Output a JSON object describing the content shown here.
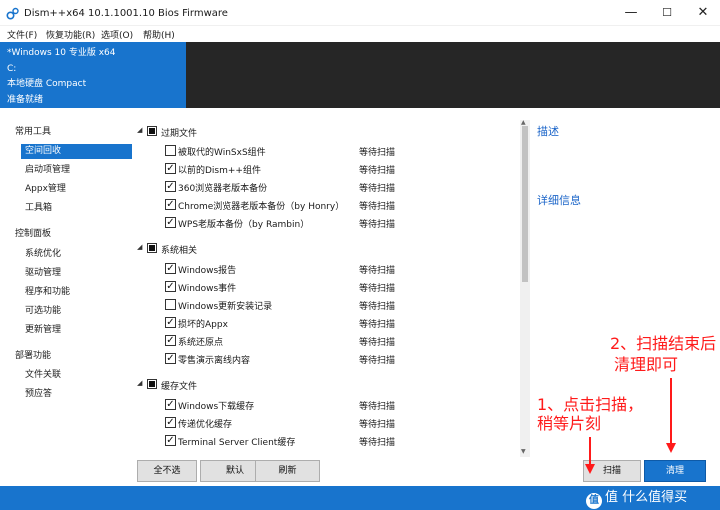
{
  "window": {
    "title": "Dism++x64 10.1.1001.10 Bios Firmware"
  },
  "menu": [
    "文件(F)",
    "恢复功能(R)",
    "选项(O)",
    "帮助(H)"
  ],
  "sysinfo": [
    "*Windows 10 专业版 x64",
    "C:",
    "本地硬盘 Compact",
    "准备就绪"
  ],
  "sidebar": {
    "categories": [
      "常用工具",
      "控制面板",
      "部署功能"
    ],
    "tools": [
      "空间回收",
      "启动项管理",
      "Appx管理",
      "工具箱"
    ],
    "control": [
      "系统优化",
      "驱动管理",
      "程序和功能",
      "可选功能",
      "更新管理"
    ],
    "deploy": [
      "文件关联",
      "预应答"
    ]
  },
  "list": {
    "groups": [
      "过期文件",
      "系统相关",
      "缓存文件"
    ],
    "status_text": "等待扫描",
    "expired": [
      {
        "label": "被取代的WinSxS组件",
        "checked": false
      },
      {
        "label": "以前的Dism++组件",
        "checked": true
      },
      {
        "label": "360浏览器老版本备份",
        "checked": true
      },
      {
        "label": "Chrome浏览器老版本备份（by Honry）",
        "checked": true
      },
      {
        "label": "WPS老版本备份（by Rambin）",
        "checked": true
      }
    ],
    "system": [
      {
        "label": "Windows报告",
        "checked": true
      },
      {
        "label": "Windows事件",
        "checked": true
      },
      {
        "label": "Windows更新安装记录",
        "checked": false
      },
      {
        "label": "损坏的Appx",
        "checked": true
      },
      {
        "label": "系统还原点",
        "checked": true
      },
      {
        "label": "零售演示离线内容",
        "checked": true
      }
    ],
    "cache": [
      {
        "label": "Windows下载缓存",
        "checked": true
      },
      {
        "label": "传递优化缓存",
        "checked": true
      },
      {
        "label": "Terminal Server Client缓存",
        "checked": true
      }
    ]
  },
  "buttons": {
    "deselect_all": "全不选",
    "default": "默认",
    "refresh": "刷新",
    "scan": "扫描",
    "clean": "清理"
  },
  "right_panel": {
    "description": "描述",
    "details": "详细信息"
  },
  "annotations": {
    "step1_line1": "1、点击扫描，",
    "step1_line2": "稍等片刻",
    "step2_line1": "2、扫描结束后",
    "step2_line2": "清理即可",
    "color": "#ff1a1a"
  },
  "watermark": "值 什么值得买",
  "colors": {
    "accent": "#1874cd",
    "dark_panel": "#262626",
    "link": "#1a64c8"
  }
}
